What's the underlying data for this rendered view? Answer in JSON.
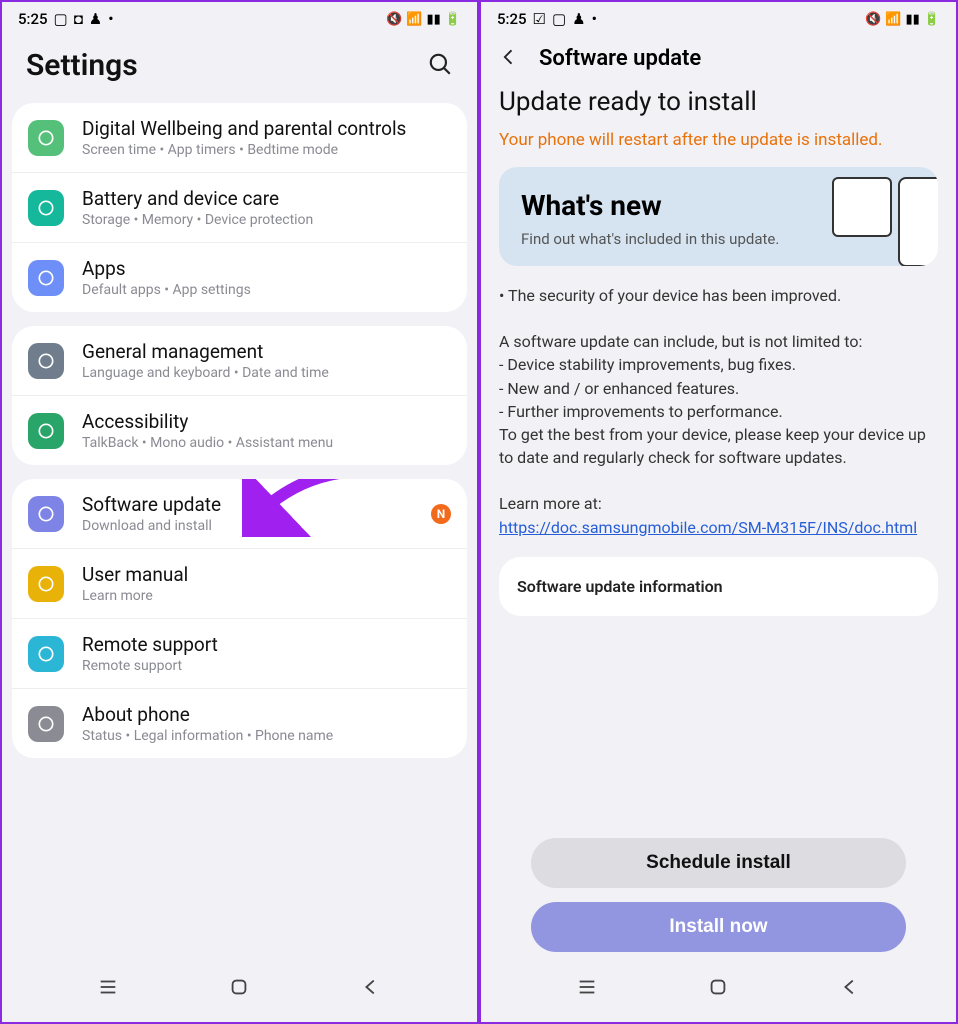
{
  "status": {
    "time": "5:25",
    "dot": "•"
  },
  "left": {
    "title": "Settings",
    "groups": [
      {
        "items": [
          {
            "key": "wellbeing",
            "title": "Digital Wellbeing and parental controls",
            "sub": "Screen time  •  App timers  •  Bedtime mode",
            "iconColor": "#55c07a",
            "iconName": "wellbeing-icon"
          },
          {
            "key": "battery",
            "title": "Battery and device care",
            "sub": "Storage  •  Memory  •  Device protection",
            "iconColor": "#15b89a",
            "iconName": "battery-care-icon"
          },
          {
            "key": "apps",
            "title": "Apps",
            "sub": "Default apps  •  App settings",
            "iconColor": "#6f8ff8",
            "iconName": "apps-icon"
          }
        ]
      },
      {
        "items": [
          {
            "key": "general",
            "title": "General management",
            "sub": "Language and keyboard  •  Date and time",
            "iconColor": "#6f7d8c",
            "iconName": "sliders-icon"
          },
          {
            "key": "accessibility",
            "title": "Accessibility",
            "sub": "TalkBack  •  Mono audio  •  Assistant menu",
            "iconColor": "#2aa56a",
            "iconName": "accessibility-icon"
          }
        ]
      },
      {
        "items": [
          {
            "key": "software-update",
            "title": "Software update",
            "sub": "Download and install",
            "iconColor": "#7d84e6",
            "iconName": "refresh-icon",
            "badge": "N",
            "arrow": true
          },
          {
            "key": "user-manual",
            "title": "User manual",
            "sub": "Learn more",
            "iconColor": "#e8b208",
            "iconName": "manual-icon"
          },
          {
            "key": "remote-support",
            "title": "Remote support",
            "sub": "Remote support",
            "iconColor": "#2cb6d6",
            "iconName": "headset-icon"
          },
          {
            "key": "about",
            "title": "About phone",
            "sub": "Status  •  Legal information  •  Phone name",
            "iconColor": "#8b8b93",
            "iconName": "info-icon"
          }
        ]
      }
    ]
  },
  "right": {
    "header": "Software update",
    "ready": "Update ready to install",
    "warn": "Your phone will restart after the update is installed.",
    "whatsnew_title": "What's new",
    "whatsnew_sub": "Find out what's included in this update.",
    "notes_bullet": "• The security of your device has been improved.",
    "notes_intro": "A software update can include, but is not limited to:",
    "notes_l1": " - Device stability improvements, bug fixes.",
    "notes_l2": " - New and / or enhanced features.",
    "notes_l3": " - Further improvements to performance.",
    "notes_tail": "To get the best from your device, please keep your device up to date and regularly check for software updates.",
    "learn_more_label": "Learn more at:",
    "learn_more_url": "https://doc.samsungmobile.com/SM-M315F/INS/doc.html",
    "info_card": "Software update information",
    "btn_schedule": "Schedule install",
    "btn_install": "Install now"
  }
}
